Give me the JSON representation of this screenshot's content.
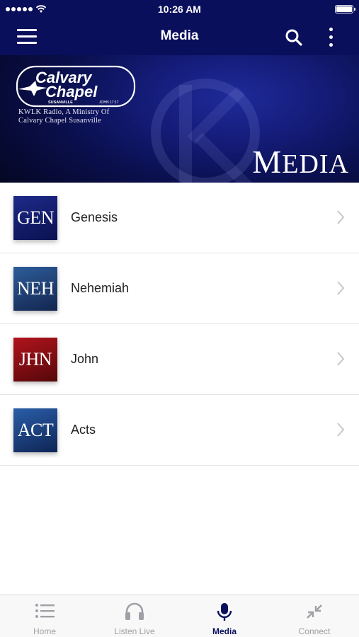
{
  "status_bar": {
    "time": "10:26 AM"
  },
  "nav": {
    "title": "Media"
  },
  "banner": {
    "logo_line1": "Calvary",
    "logo_line2": "Chapel",
    "logo_small_left": "SUSANVILLE",
    "logo_small_right": "JOHN 17:17",
    "subtitle_line1": "KWLK Radio, A Ministry Of",
    "subtitle_line2": "Calvary Chapel Susanville",
    "title_initial": "M",
    "title_rest": "EDIA"
  },
  "items": [
    {
      "abbr": "GEN",
      "label": "Genesis",
      "color_top": "#1d2a8a",
      "color_bottom": "#0b1150"
    },
    {
      "abbr": "NEH",
      "label": "Nehemiah",
      "color_top": "#2d5d9a",
      "color_bottom": "#13254f"
    },
    {
      "abbr": "JHN",
      "label": "John",
      "color_top": "#b1141b",
      "color_bottom": "#55070b"
    },
    {
      "abbr": "ACT",
      "label": "Acts",
      "color_top": "#2a5ea8",
      "color_bottom": "#0f2555"
    }
  ],
  "tabs": [
    {
      "label": "Home",
      "icon": "list-icon"
    },
    {
      "label": "Listen Live",
      "icon": "headphones-icon"
    },
    {
      "label": "Media",
      "icon": "microphone-icon"
    },
    {
      "label": "Connect",
      "icon": "collapse-arrows-icon"
    }
  ],
  "colors": {
    "accent": "#0a0f5c",
    "inactive": "#a0a0a6"
  }
}
